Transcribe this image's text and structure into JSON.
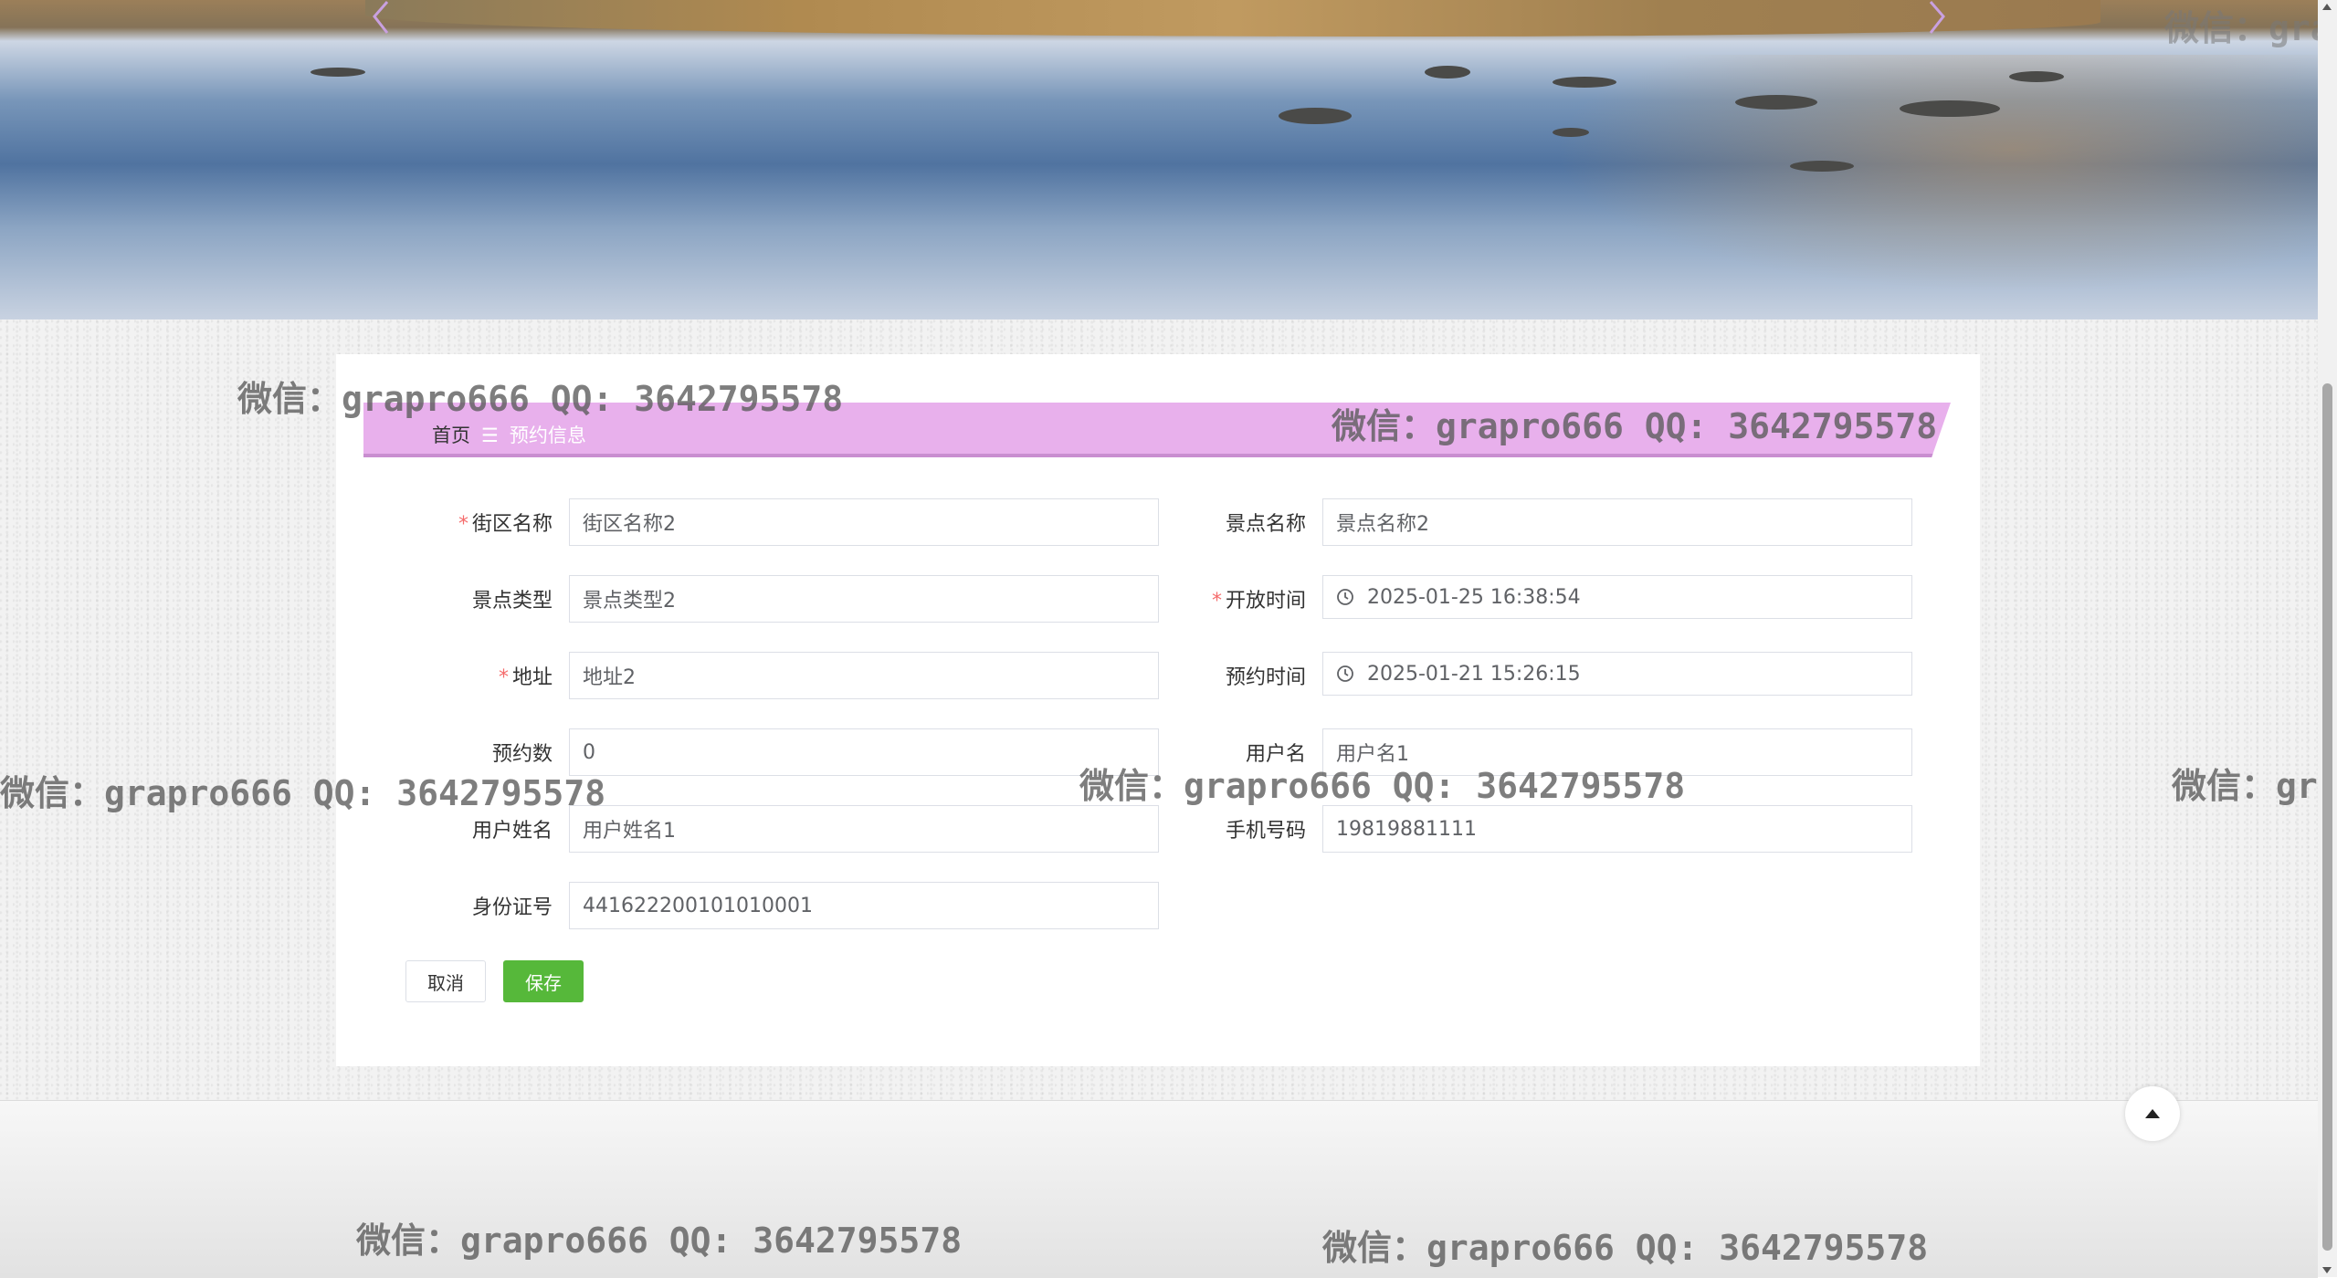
{
  "breadcrumb": {
    "home": "首页",
    "separator": "☰",
    "current": "预约信息"
  },
  "form": {
    "fields": [
      {
        "label": "街区名称",
        "required": true,
        "value": "街区名称2",
        "type": "text"
      },
      {
        "label": "景点名称",
        "required": false,
        "value": "景点名称2",
        "type": "text"
      },
      {
        "label": "景点类型",
        "required": false,
        "value": "景点类型2",
        "type": "text"
      },
      {
        "label": "开放时间",
        "required": true,
        "value": "2025-01-25 16:38:54",
        "type": "datetime"
      },
      {
        "label": "地址",
        "required": true,
        "value": "地址2",
        "type": "text"
      },
      {
        "label": "预约时间",
        "required": false,
        "value": "2025-01-21 15:26:15",
        "type": "datetime"
      },
      {
        "label": "预约数",
        "required": false,
        "value": "0",
        "type": "text"
      },
      {
        "label": "用户名",
        "required": false,
        "value": "用户名1",
        "type": "text"
      },
      {
        "label": "用户姓名",
        "required": false,
        "value": "用户姓名1",
        "type": "text"
      },
      {
        "label": "手机号码",
        "required": false,
        "value": "19819881111",
        "type": "text"
      },
      {
        "label": "身份证号",
        "required": false,
        "value": "441622200101010001",
        "type": "text"
      }
    ],
    "required_mark": "*",
    "cancel_label": "取消",
    "save_label": "保存"
  },
  "watermark": "微信：grapro666 QQ: 3642795578",
  "colors": {
    "ribbon": "#e8b0ec",
    "save_button": "#56b83a",
    "required": "#f56c6c",
    "carousel_arrow": "#c9a0e0"
  },
  "icons": {
    "carousel_prev": "chevron-left-icon",
    "carousel_next": "chevron-right-icon",
    "datetime": "clock-icon",
    "back_to_top": "caret-up-icon"
  }
}
